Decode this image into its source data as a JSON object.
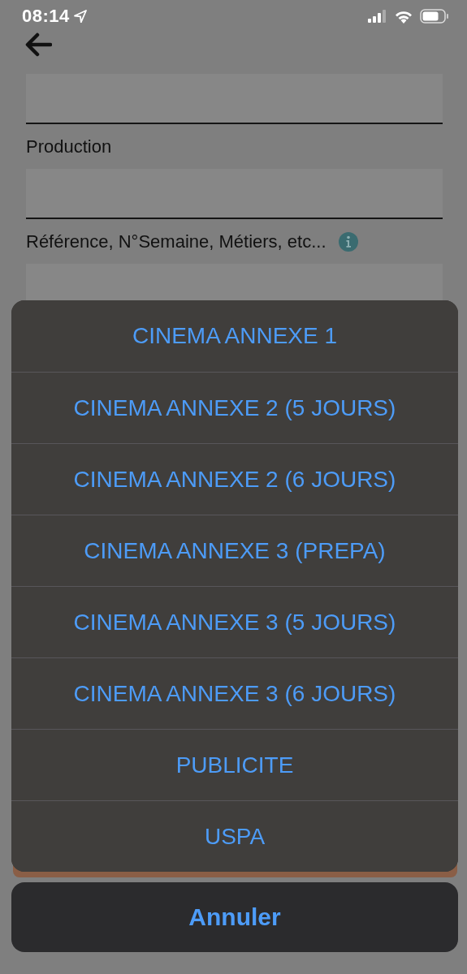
{
  "status_bar": {
    "time": "08:14"
  },
  "form": {
    "items": [
      {
        "kind": "input"
      },
      {
        "kind": "label",
        "text": "Production"
      },
      {
        "kind": "input"
      },
      {
        "kind": "label",
        "text": "Référence, N°Semaine, Métiers, etc...",
        "info": true
      },
      {
        "kind": "input"
      }
    ]
  },
  "action_sheet": {
    "options": [
      "CINEMA ANNEXE 1",
      "CINEMA ANNEXE 2 (5 JOURS)",
      "CINEMA ANNEXE 2 (6 JOURS)",
      "CINEMA ANNEXE 3 (PREPA)",
      "CINEMA ANNEXE 3 (5 JOURS)",
      "CINEMA ANNEXE 3 (6 JOURS)",
      "PUBLICITE",
      "USPA"
    ],
    "cancel": "Annuler"
  }
}
